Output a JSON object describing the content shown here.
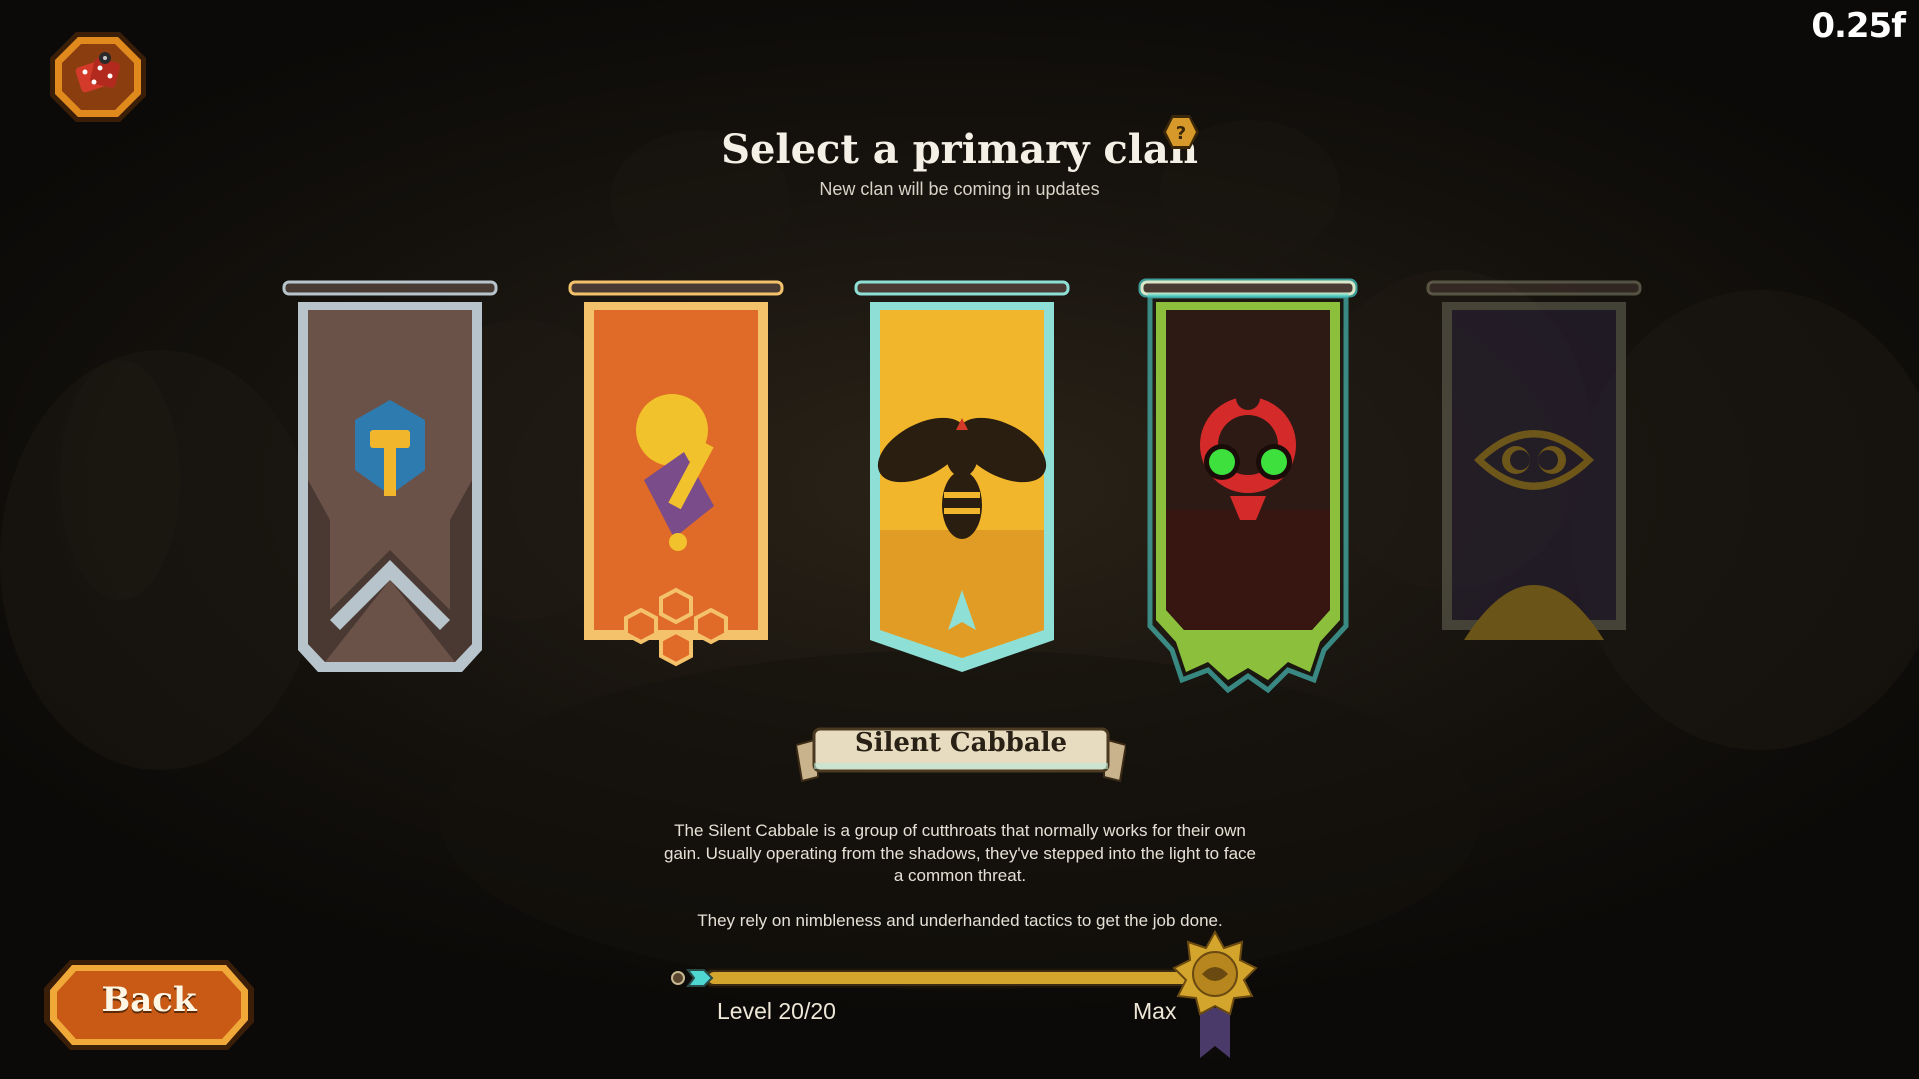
{
  "hud": {
    "fps_readout": "0.25f"
  },
  "header": {
    "title": "Select a primary clan",
    "subtitle": "New clan will be coming in updates"
  },
  "clans": [
    {
      "id": "hammer",
      "state": "available",
      "icon": "hammer-shield-icon",
      "color": "#6a5248",
      "trim": "#b8c4cc"
    },
    {
      "id": "honey",
      "state": "available",
      "icon": "honey-dipper-icon",
      "color": "#e06a28",
      "trim": "#f4c26a"
    },
    {
      "id": "wasp",
      "state": "available",
      "icon": "wasp-icon",
      "color": "#f2b62c",
      "trim": "#8ee0d6"
    },
    {
      "id": "silent-cabbale",
      "state": "selected",
      "icon": "biohazard-mask-icon",
      "color": "#2e1a14",
      "trim": "#8bbf3c"
    },
    {
      "id": "eye",
      "state": "locked",
      "icon": "all-seeing-eye-icon",
      "color": "#2a2238",
      "trim": "#8a8a70"
    }
  ],
  "selected_clan": {
    "name": "Silent Cabbale",
    "description_1": "The Silent Cabbale is a group of cutthroats that normally works for their own gain. Usually operating from the shadows, they've stepped into the light to face a common threat.",
    "description_2": "They rely on nimbleness and underhanded tactics to get the job done."
  },
  "progress": {
    "level_label": "Level 20/20",
    "max_label": "Max",
    "fraction": 1.0
  },
  "buttons": {
    "back_label": "Back"
  },
  "colors": {
    "accent_orange": "#e08a1e",
    "gold": "#d4a52c",
    "selected_glow": "#4fd6d0"
  }
}
